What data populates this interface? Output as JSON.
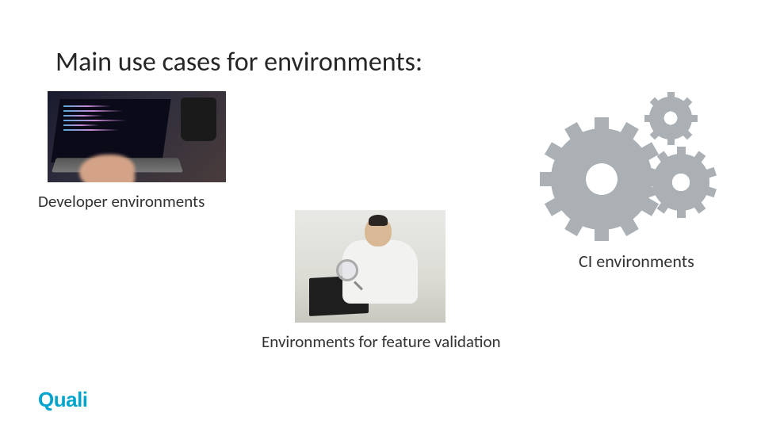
{
  "title": "Main use cases for environments:",
  "useCases": {
    "dev": {
      "label": "Developer environments"
    },
    "validation": {
      "label": "Environments for feature validation"
    },
    "ci": {
      "label": "CI environments"
    }
  },
  "brand": {
    "name": "Quali",
    "color": "#00a4cc"
  }
}
